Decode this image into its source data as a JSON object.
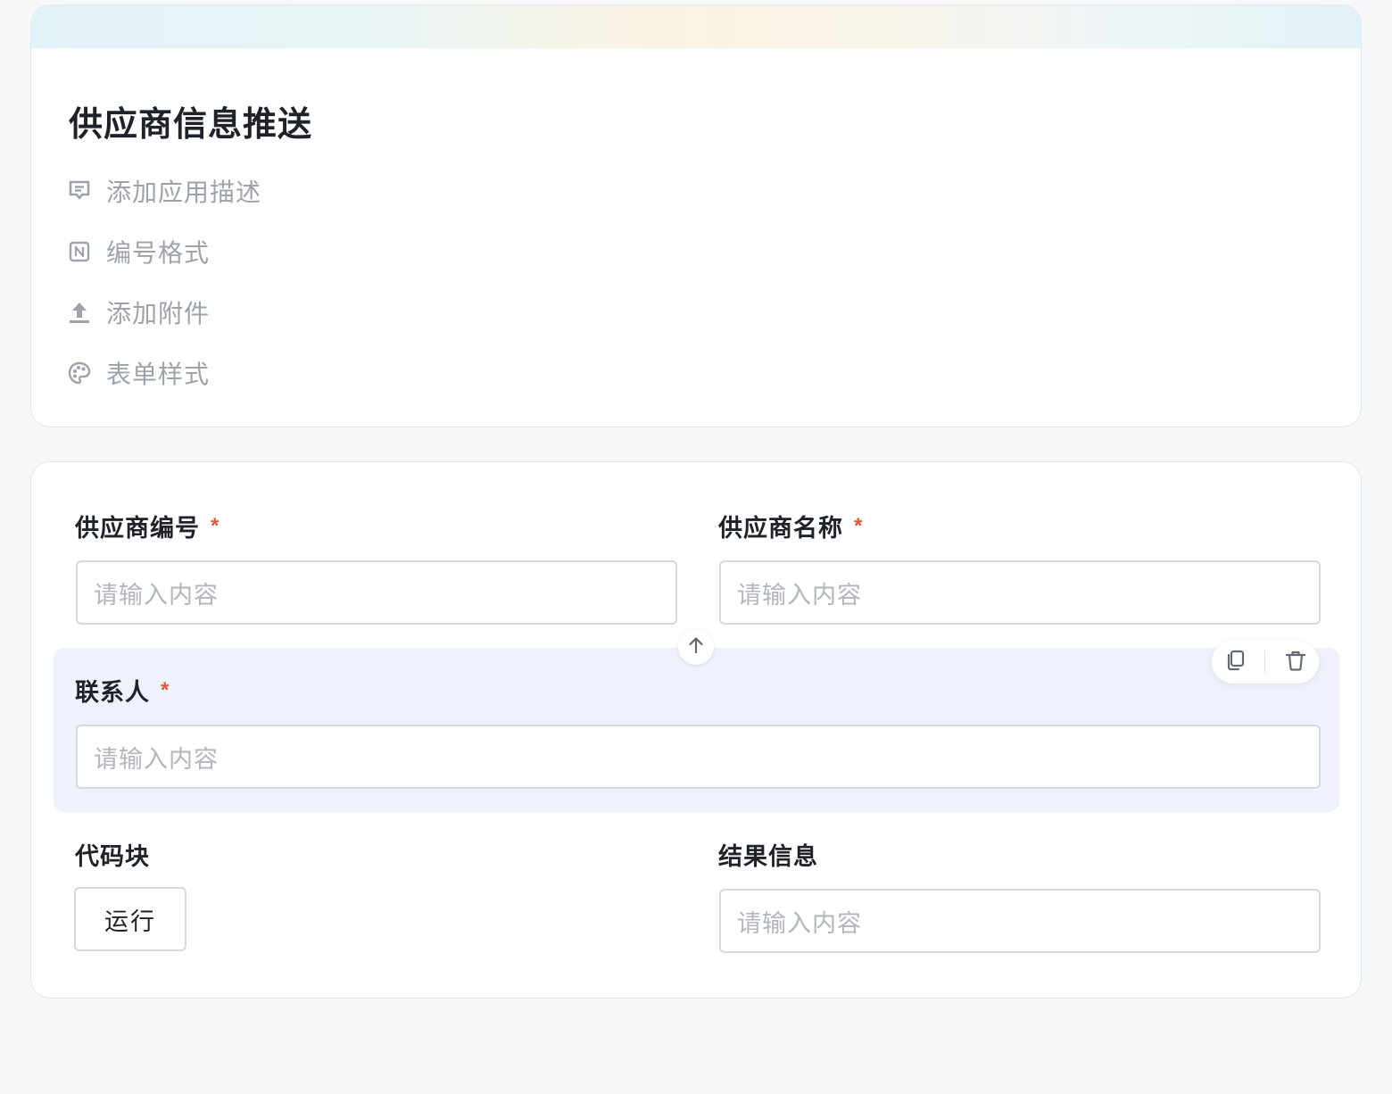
{
  "header": {
    "title": "供应商信息推送",
    "settings": [
      {
        "label": "添加应用描述",
        "icon": "comment-icon"
      },
      {
        "label": "编号格式",
        "icon": "numbering-icon"
      },
      {
        "label": "添加附件",
        "icon": "upload-icon"
      },
      {
        "label": "表单样式",
        "icon": "palette-icon"
      }
    ]
  },
  "form": {
    "required_mark": "*",
    "fields": {
      "supplier_code": {
        "label": "供应商编号",
        "placeholder": "请输入内容",
        "required": true
      },
      "supplier_name": {
        "label": "供应商名称",
        "placeholder": "请输入内容",
        "required": true
      },
      "contact": {
        "label": "联系人",
        "placeholder": "请输入内容",
        "required": true
      },
      "code_block": {
        "label": "代码块",
        "button_label": "运行"
      },
      "result_info": {
        "label": "结果信息",
        "placeholder": "请输入内容",
        "required": false
      }
    },
    "row_actions": {
      "move_up_icon": "arrow-up-icon",
      "copy_icon": "copy-icon",
      "delete_icon": "trash-icon"
    }
  },
  "colors": {
    "background": "#f7f8fa",
    "selected_row": "#eff2fc",
    "required_star": "#e0573f",
    "placeholder": "#b2b6bd",
    "setting_text": "#9ea3ab"
  }
}
